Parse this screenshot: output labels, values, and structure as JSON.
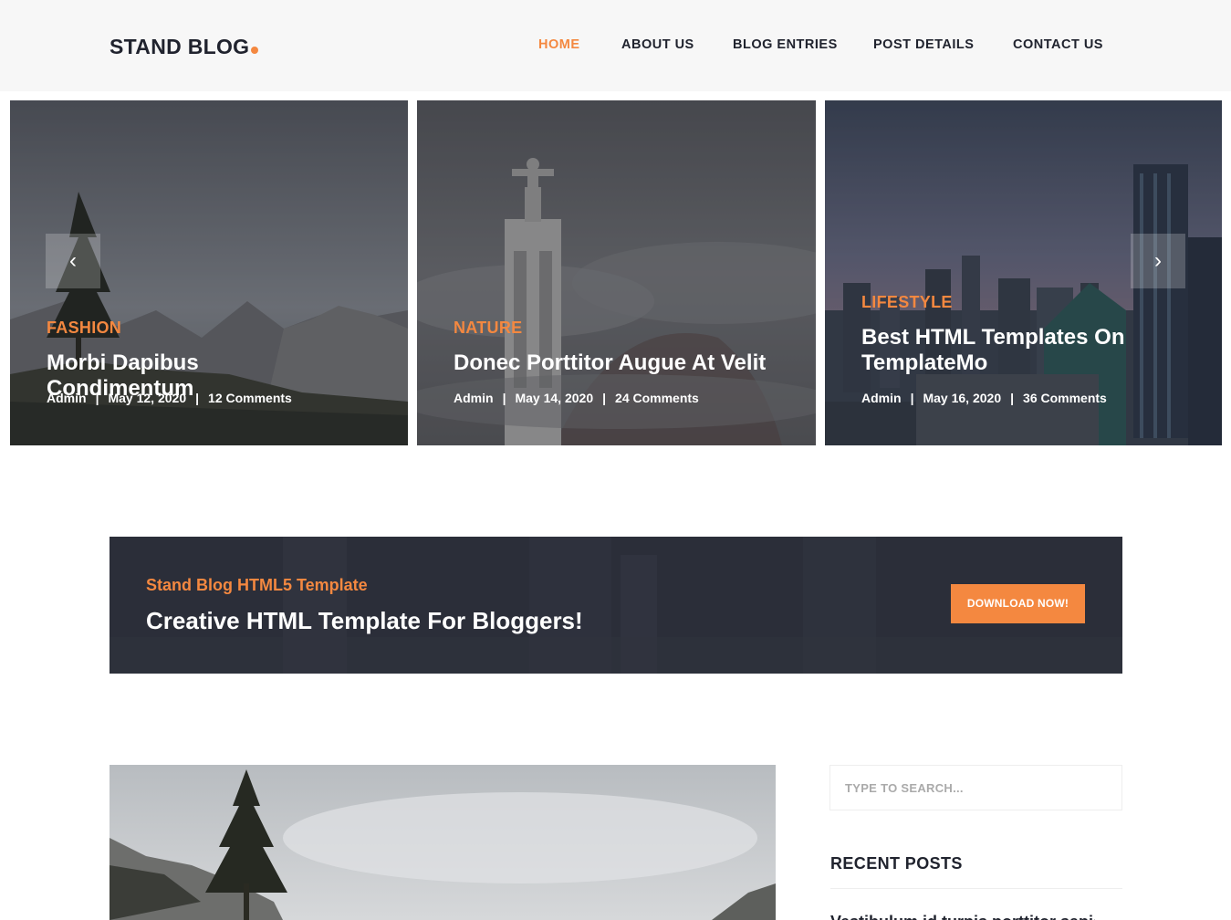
{
  "colors": {
    "accent": "#f48840",
    "dark": "#20232e",
    "banner": "#2c2f3a"
  },
  "header": {
    "logo": "STAND BLOG",
    "nav": [
      {
        "label": "HOME",
        "active": true
      },
      {
        "label": "ABOUT US",
        "active": false
      },
      {
        "label": "BLOG ENTRIES",
        "active": false
      },
      {
        "label": "POST DETAILS",
        "active": false
      },
      {
        "label": "CONTACT US",
        "active": false
      }
    ]
  },
  "slider": {
    "prev_icon": "‹",
    "next_icon": "›",
    "slides": [
      {
        "category": "FASHION",
        "title": "Morbi Dapibus Condimentum",
        "author": "Admin",
        "date": "May 12, 2020",
        "comments": "12 Comments"
      },
      {
        "category": "NATURE",
        "title": "Donec Porttitor Augue At Velit",
        "author": "Admin",
        "date": "May 14, 2020",
        "comments": "24 Comments"
      },
      {
        "category": "LIFESTYLE",
        "title": "Best HTML Templates On TemplateMo",
        "author": "Admin",
        "date": "May 16, 2020",
        "comments": "36 Comments"
      }
    ]
  },
  "cta": {
    "subtitle": "Stand Blog HTML5 Template",
    "title": "Creative HTML Template For Bloggers!",
    "button": "DOWNLOAD NOW!"
  },
  "sidebar": {
    "search_placeholder": "TYPE TO SEARCH...",
    "recent_title": "RECENT POSTS",
    "recent_first": "Vestibulum id turpis porttitor sapien"
  }
}
